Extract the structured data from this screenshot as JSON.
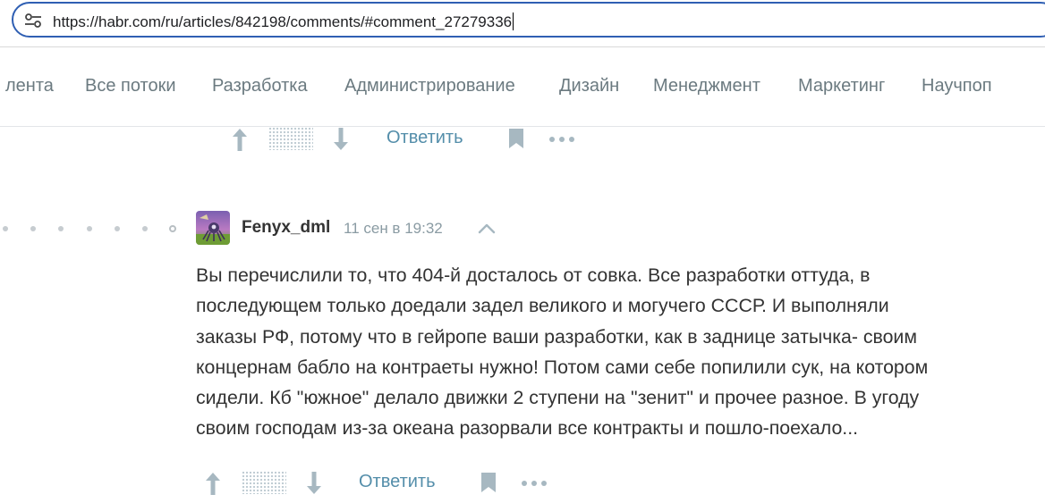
{
  "browser": {
    "url": "https://habr.com/ru/articles/842198/comments/#comment_27279336"
  },
  "nav": {
    "items": [
      "лента",
      "Все потоки",
      "Разработка",
      "Администрирование",
      "Дизайн",
      "Менеджмент",
      "Маркетинг",
      "Научпоп"
    ]
  },
  "top_actions": {
    "reply_label": "Ответить"
  },
  "comment": {
    "author": "Fenyx_dml",
    "time": "11 сен в 19:32",
    "lines": [
      "Вы перечислили то, что 404-й досталось от совка. Все разработки оттуда, в",
      "последующем только доедали задел великого и могучего СССР. И выполняли",
      "заказы РФ, потому что в гейропе ваши разработки, как в заднице затычка- своим",
      "концернам бабло на контраеты нужно! Потом сами себе попилили сук, на котором",
      "сидели. Кб \"южное\" делало движки 2 ступени на \"зенит\" и прочее разное. В угоду",
      "своим господам из-за океана разорвали все контракты и пошло-поехало..."
    ],
    "reply_label": "Ответить"
  },
  "icons": {
    "upvote": "arrow-up-icon",
    "downvote": "arrow-down-icon",
    "bookmark": "bookmark-icon",
    "more": "more-dots-icon",
    "collapse": "chevron-up-icon",
    "site_settings": "tune-icon"
  },
  "colors": {
    "link": "#548eaa",
    "icon": "#a7b8c1",
    "nav_text": "#6b7a80",
    "url_focus": "#2f5fb3"
  }
}
